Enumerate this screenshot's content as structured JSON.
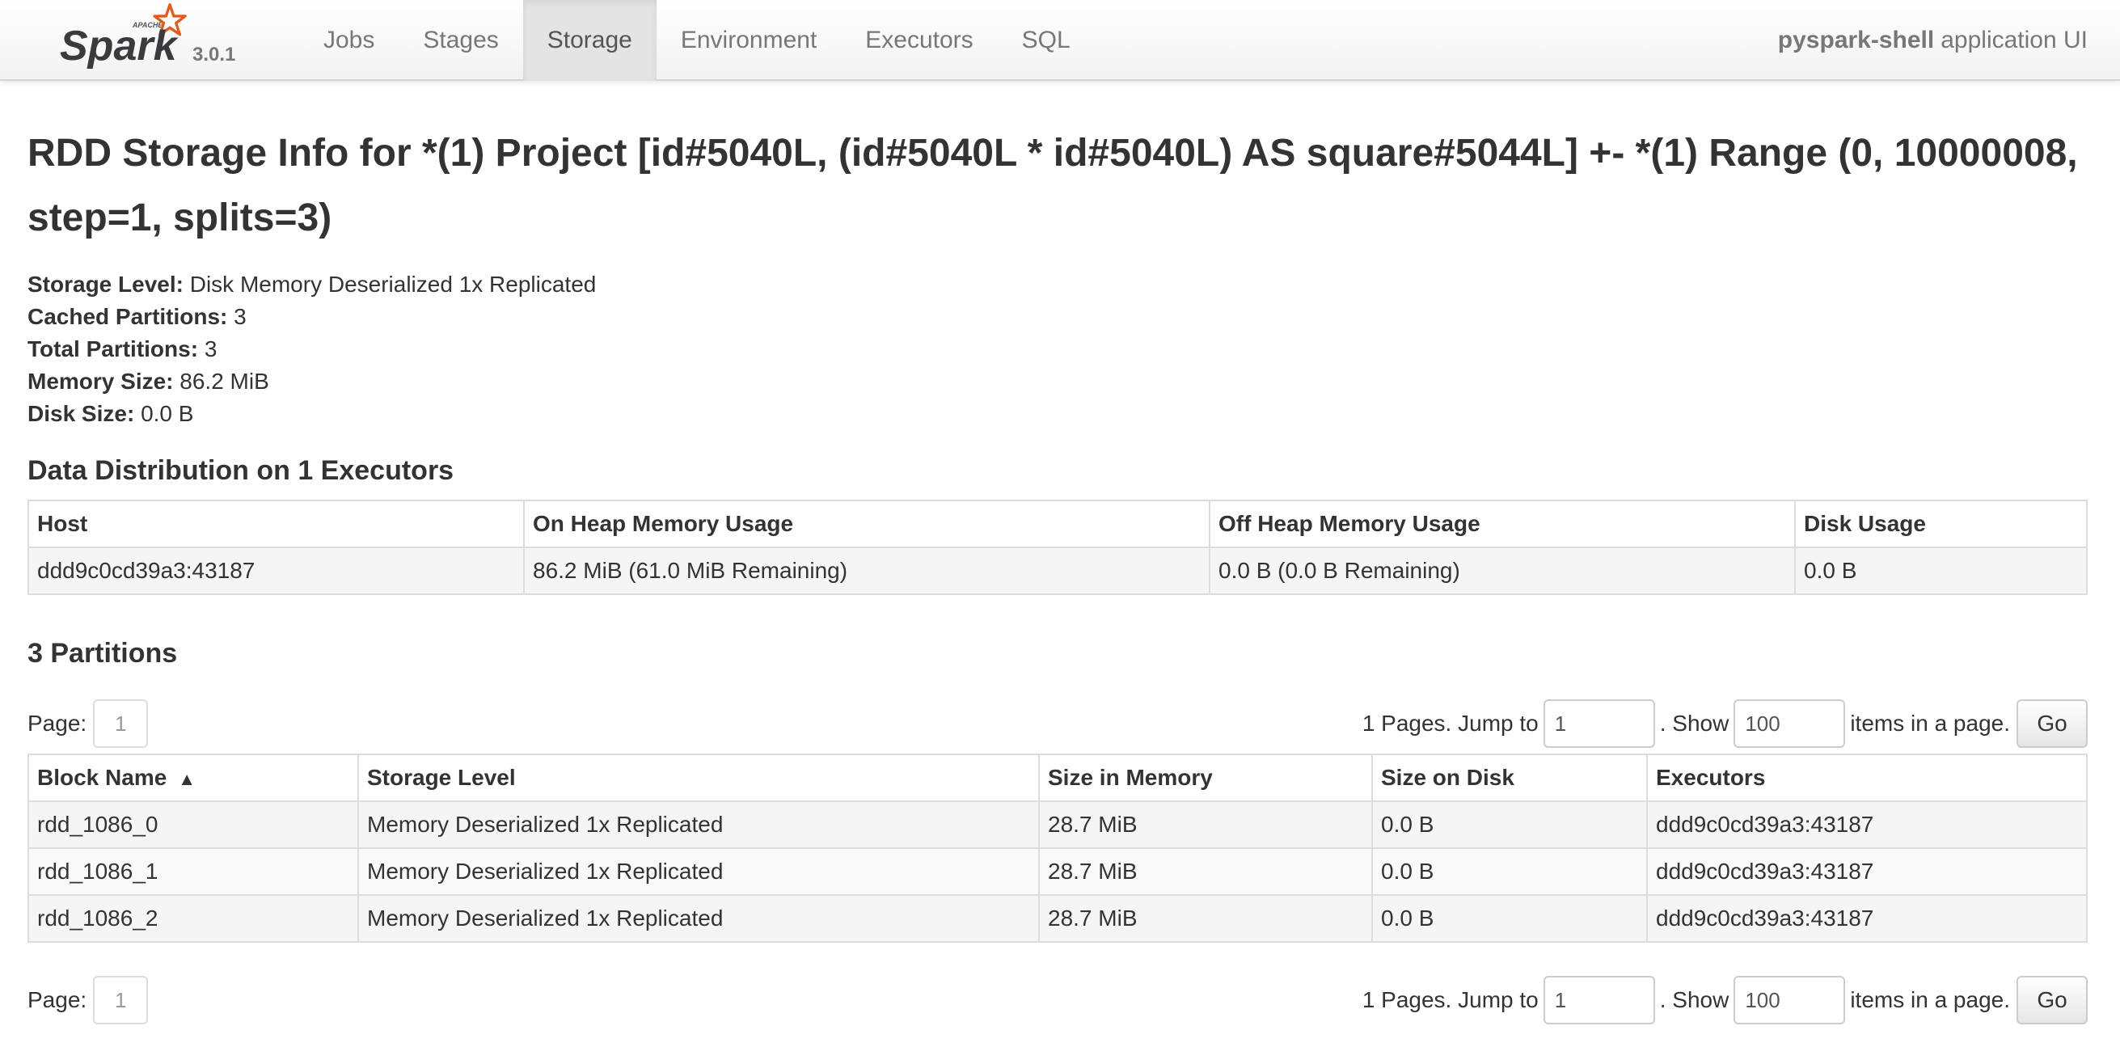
{
  "navbar": {
    "logo_apache": "APACHE",
    "logo_text": "Spark",
    "version": "3.0.1",
    "tabs": [
      {
        "label": "Jobs",
        "active": false
      },
      {
        "label": "Stages",
        "active": false
      },
      {
        "label": "Storage",
        "active": true
      },
      {
        "label": "Environment",
        "active": false
      },
      {
        "label": "Executors",
        "active": false
      },
      {
        "label": "SQL",
        "active": false
      }
    ],
    "app_name": "pyspark-shell",
    "app_suffix": "application UI"
  },
  "page": {
    "title": "RDD Storage Info for *(1) Project [id#5040L, (id#5040L * id#5040L) AS square#5044L] +- *(1) Range (0, 10000008, step=1, splits=3)",
    "summary": [
      {
        "label": "Storage Level:",
        "value": "Disk Memory Deserialized 1x Replicated"
      },
      {
        "label": "Cached Partitions:",
        "value": "3"
      },
      {
        "label": "Total Partitions:",
        "value": "3"
      },
      {
        "label": "Memory Size:",
        "value": "86.2 MiB"
      },
      {
        "label": "Disk Size:",
        "value": "0.0 B"
      }
    ]
  },
  "distribution": {
    "heading": "Data Distribution on 1 Executors",
    "columns": [
      "Host",
      "On Heap Memory Usage",
      "Off Heap Memory Usage",
      "Disk Usage"
    ],
    "rows": [
      [
        "ddd9c0cd39a3:43187",
        "86.2 MiB (61.0 MiB Remaining)",
        "0.0 B (0.0 B Remaining)",
        "0.0 B"
      ]
    ]
  },
  "partitions": {
    "heading": "3 Partitions",
    "pager": {
      "page_label": "Page:",
      "current_page": "1",
      "pages_text": "1 Pages. Jump to",
      "jump_value": "1",
      "show_text": ". Show",
      "page_size": "100",
      "items_text": "items in a page.",
      "go_label": "Go"
    },
    "columns": [
      "Block Name",
      "Storage Level",
      "Size in Memory",
      "Size on Disk",
      "Executors"
    ],
    "sort_icon": "▲",
    "rows": [
      [
        "rdd_1086_0",
        "Memory Deserialized 1x Replicated",
        "28.7 MiB",
        "0.0 B",
        "ddd9c0cd39a3:43187"
      ],
      [
        "rdd_1086_1",
        "Memory Deserialized 1x Replicated",
        "28.7 MiB",
        "0.0 B",
        "ddd9c0cd39a3:43187"
      ],
      [
        "rdd_1086_2",
        "Memory Deserialized 1x Replicated",
        "28.7 MiB",
        "0.0 B",
        "ddd9c0cd39a3:43187"
      ]
    ]
  }
}
